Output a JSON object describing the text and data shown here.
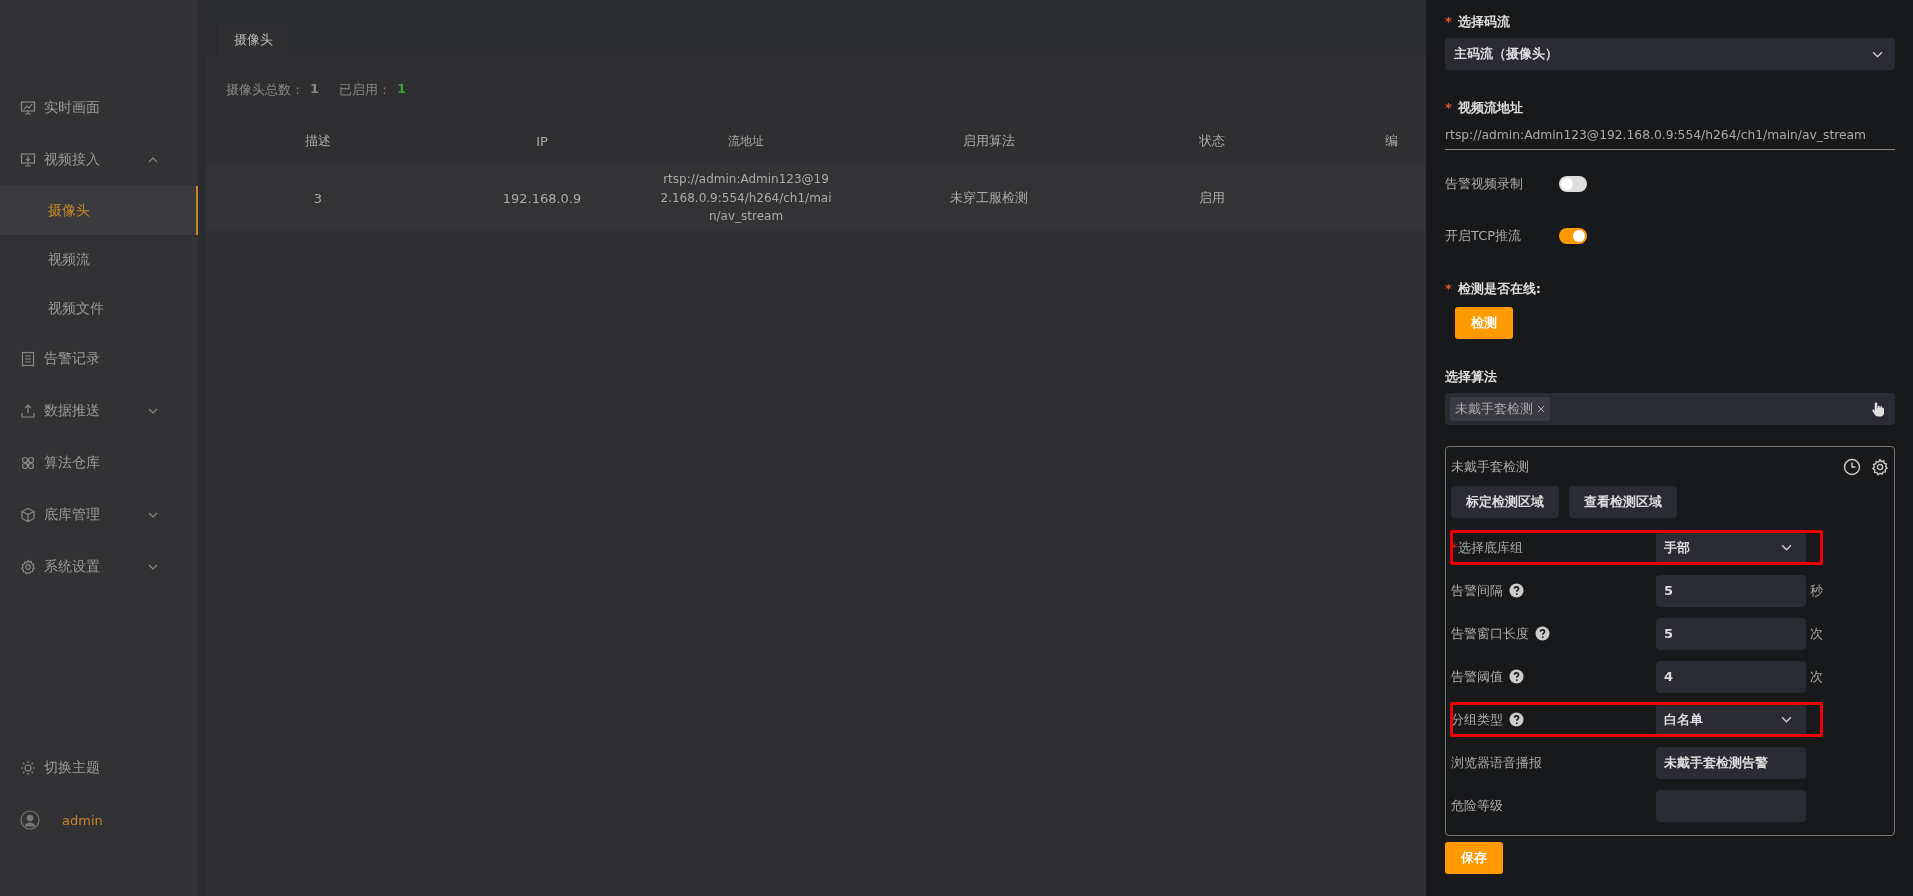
{
  "sidebar": {
    "items": [
      {
        "label": "实时画面",
        "selected": false
      },
      {
        "label": "视频接入",
        "expanded": true,
        "selected": false,
        "children": [
          {
            "label": "摄像头",
            "selected": true
          },
          {
            "label": "视频流",
            "selected": false
          },
          {
            "label": "视频文件",
            "selected": false
          }
        ]
      },
      {
        "label": "告警记录",
        "selected": false
      },
      {
        "label": "数据推送",
        "expanded": false,
        "selected": false
      },
      {
        "label": "算法仓库",
        "selected": false
      },
      {
        "label": "底库管理",
        "expanded": false,
        "selected": false
      },
      {
        "label": "系统设置",
        "expanded": false,
        "selected": false
      }
    ],
    "theme_switch": "切换主题",
    "user": "admin"
  },
  "tabs": [
    {
      "label": "摄像头",
      "selected": true
    }
  ],
  "summary": {
    "total_label": "摄像头总数：",
    "total": "1",
    "enabled_label": "已启用：",
    "enabled": "1"
  },
  "table": {
    "columns": [
      "描述",
      "IP",
      "流地址",
      "启用算法",
      "状态",
      "编"
    ],
    "rows": [
      [
        "3",
        "192.168.0.9",
        "rtsp://admin:Admin123@192.168.0.9:554/h264/ch1/main/av_stream",
        "未穿工服检测",
        "启用"
      ]
    ]
  },
  "panel": {
    "stream_select": {
      "label": "选择码流",
      "required_mark": "*",
      "value": "主码流（摄像头）"
    },
    "stream_url": {
      "label": "视频流地址",
      "required_mark": "*",
      "value": "rtsp://admin:Admin123@192.168.0.9:554/h264/ch1/main/av_stream"
    },
    "toggles": [
      {
        "label": "告警视频录制",
        "on": false
      },
      {
        "label": "开启TCP推流",
        "on": true
      }
    ],
    "online_check": {
      "label": "检测是否在线:",
      "required_mark": "*",
      "button": "检测"
    },
    "algorithm": {
      "label": "选择算法",
      "tags": [
        "未戴手套检测"
      ]
    },
    "card": {
      "title": "未戴手套检测",
      "buttons": [
        "标定检测区域",
        "查看检测区域"
      ],
      "rows": [
        {
          "kind": "select",
          "label": "选择底库组",
          "required_mark": "*",
          "help": false,
          "value": "手部",
          "highlighted": true
        },
        {
          "kind": "input",
          "label": "告警间隔",
          "help": true,
          "value": "5",
          "unit": "秒",
          "highlighted": false
        },
        {
          "kind": "input",
          "label": "告警窗口长度",
          "help": true,
          "value": "5",
          "unit": "次",
          "highlighted": false
        },
        {
          "kind": "input",
          "label": "告警阈值",
          "help": true,
          "value": "4",
          "unit": "次",
          "highlighted": false
        },
        {
          "kind": "select",
          "label": "分组类型",
          "help": true,
          "value": "白名单",
          "highlighted": true
        },
        {
          "kind": "input",
          "label": "浏览器语音播报",
          "help": false,
          "value": "未戴手套检测告警",
          "highlighted": false
        },
        {
          "kind": "input",
          "label": "危险等级",
          "help": false,
          "highlighted": false
        }
      ]
    },
    "save": "保存"
  }
}
